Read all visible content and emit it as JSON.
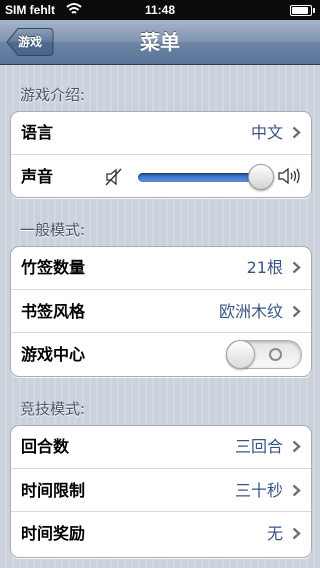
{
  "status_bar": {
    "carrier": "SIM fehlt",
    "time": "11:48"
  },
  "nav": {
    "title": "菜单",
    "back_label": "游戏"
  },
  "sections": [
    {
      "header": "游戏介绍:",
      "rows": [
        {
          "label": "语言",
          "value": "中文"
        },
        {
          "label": "声音",
          "volume_level": 0.95
        }
      ]
    },
    {
      "header": "一般模式:",
      "rows": [
        {
          "label": "竹签数量",
          "value": "21根"
        },
        {
          "label": "书签风格",
          "value": "欧洲木纹"
        },
        {
          "label": "游戏中心",
          "toggle_on": false
        }
      ]
    },
    {
      "header": "竞技模式:",
      "rows": [
        {
          "label": "回合数",
          "value": "三回合"
        },
        {
          "label": "时间限制",
          "value": "三十秒"
        },
        {
          "label": "时间奖励",
          "value": "无"
        }
      ]
    }
  ],
  "icons": {
    "wifi": "wifi-icon",
    "battery": "battery-icon",
    "back": "back-arrow-icon",
    "chevron": "chevron-right-icon",
    "mute": "speaker-mute-icon",
    "loud": "speaker-loud-icon"
  },
  "colors": {
    "nav_blue": "#6d85a5",
    "value_blue": "#385487",
    "slider_blue": "#3a6fcf"
  }
}
